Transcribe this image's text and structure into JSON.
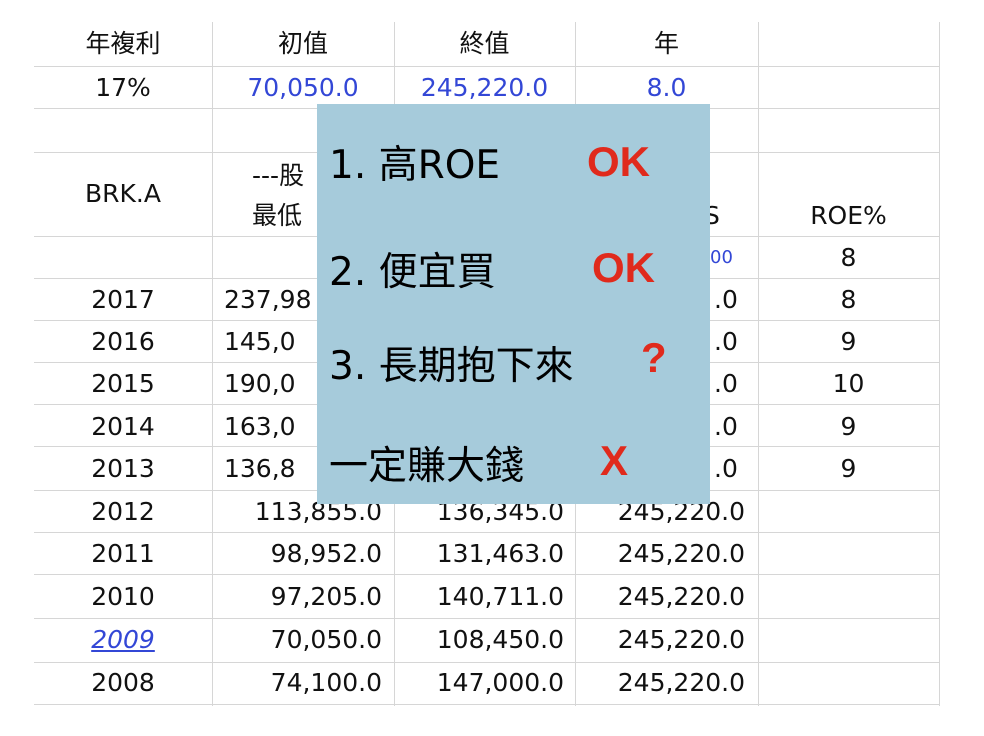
{
  "summary": {
    "headers": [
      "年複利",
      "初值",
      "終值",
      "年"
    ],
    "values": [
      "17%",
      "70,050.0",
      "245,220.0",
      "8.0"
    ]
  },
  "table": {
    "header_left": "BRK.A",
    "header_top_mid": "---股",
    "header_col2": "最低",
    "header_col4_partial": "S",
    "header_roe": "ROE%",
    "partial_eps": "00",
    "roe_first": "8",
    "rows": [
      {
        "year": "2017",
        "low": "237,98",
        "high": "",
        "eps": ".0",
        "roe": "8"
      },
      {
        "year": "2016",
        "low": "145,0",
        "high": "",
        "eps": ".0",
        "roe": "9"
      },
      {
        "year": "2015",
        "low": "190,0",
        "high": "",
        "eps": ".0",
        "roe": "10"
      },
      {
        "year": "2014",
        "low": "163,0",
        "high": "",
        "eps": ".0",
        "roe": "9"
      },
      {
        "year": "2013",
        "low": "136,8",
        "high": "",
        "eps": ".0",
        "roe": "9"
      },
      {
        "year": "2012",
        "low": "113,855.0",
        "high": "136,345.0",
        "eps": "245,220.0",
        "roe": ""
      },
      {
        "year": "2011",
        "low": "98,952.0",
        "high": "131,463.0",
        "eps": "245,220.0",
        "roe": ""
      },
      {
        "year": "2010",
        "low": "97,205.0",
        "high": "140,711.0",
        "eps": "245,220.0",
        "roe": ""
      },
      {
        "year": "2009",
        "low": "70,050.0",
        "high": "108,450.0",
        "eps": "245,220.0",
        "roe": ""
      },
      {
        "year": "2008",
        "low": "74,100.0",
        "high": "147,000.0",
        "eps": "245,220.0",
        "roe": ""
      }
    ]
  },
  "overlay": {
    "items": [
      {
        "text": "1.  高ROE",
        "mark": "OK"
      },
      {
        "text": "2.  便宜買",
        "mark": "OK"
      },
      {
        "text": "3.  長期抱下來",
        "mark": "?"
      },
      {
        "text": "一定賺大錢",
        "mark": "X"
      }
    ]
  },
  "colors": {
    "blue_value": "#3347d6",
    "overlay_bg": "#a6cbdb",
    "mark_red": "#e02a1c"
  }
}
